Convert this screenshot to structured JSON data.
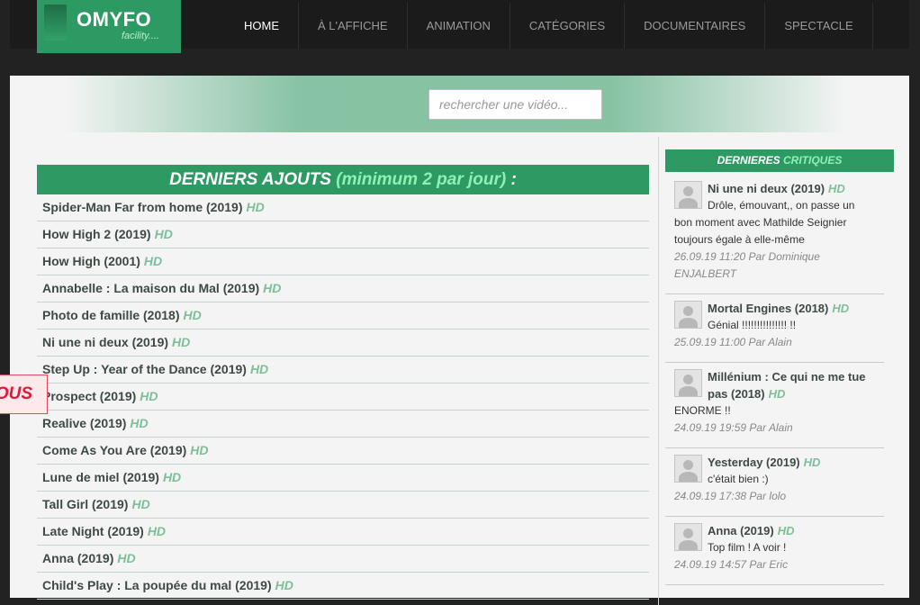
{
  "logo": {
    "title": "OMYFO",
    "subtitle": "facility...."
  },
  "nav": [
    "HOME",
    "À L'AFFICHE",
    "ANIMATION",
    "CATÉGORIES",
    "DOCUMENTAIRES",
    "SPECTACLE"
  ],
  "search": {
    "placeholder": "rechercher une vidéo..."
  },
  "latest": {
    "header": "DERNIERS AJOUTS",
    "header_accent": "(minimum 2 par jour)",
    "header_suffix": " :",
    "hd_label": "HD",
    "items": [
      "Spider-Man Far from home (2019)",
      "How High 2 (2019)",
      "How High (2001)",
      "Annabelle : La maison du Mal (2019)",
      "Photo de famille (2018)",
      "Ni une ni deux (2019)",
      "Step Up : Year of the Dance (2019)",
      "Prospect (2019)",
      "Realive (2019)",
      "Come As You Are (2019)",
      "Lune de miel (2019)",
      "Tall Girl (2019)",
      "Late Night (2019)",
      "Anna (2019)",
      "Child's Play : La poupée du mal (2019)"
    ]
  },
  "reviews": {
    "header": "DERNIERES",
    "header_accent": "CRITIQUES",
    "items": [
      {
        "title": "Ni une ni deux (2019)",
        "text": "Drôle, émouvant,, on passe un bon moment avec Mathilde Seignier toujours égale à elle-même",
        "meta": "26.09.19 11:20 Par Dominique ENJALBERT"
      },
      {
        "title": "Mortal Engines (2018)",
        "text": "Génial !!!!!!!!!!!!!!! !!",
        "meta": "25.09.19 11:00 Par Alain"
      },
      {
        "title": "Millénium : Ce qui ne me tue pas (2018)",
        "text": "ENORME !!",
        "meta": "24.09.19 19:59 Par Alain"
      },
      {
        "title": "Yesterday (2019)",
        "text": "c'était bien :)",
        "meta": "24.09.19 17:38 Par lolo"
      },
      {
        "title": "Anna (2019)",
        "text": "Top film ! A voir !",
        "meta": "24.09.19 14:57 Par Eric"
      }
    ]
  },
  "floating_tab": {
    "label": "OUS"
  },
  "colors": {
    "brand": "#2e9a63",
    "accent": "#8ff0b5",
    "hd": "#7cbf98",
    "alert": "#e0173a"
  }
}
